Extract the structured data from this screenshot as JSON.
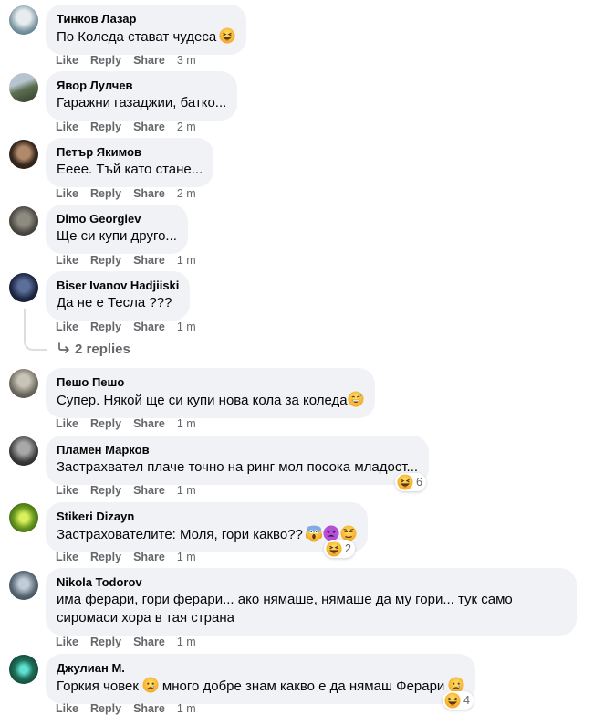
{
  "actions": {
    "like": "Like",
    "reply": "Reply",
    "share": "Share"
  },
  "comments": [
    {
      "author": "Тинков Лазар",
      "text": "По Коледа стават чудеса",
      "time": "3 m",
      "emoji": [
        "laughing"
      ]
    },
    {
      "author": "Явор Лулчев",
      "text": "Гаражни газаджии, батко...",
      "time": "2 m"
    },
    {
      "author": "Петър Якимов",
      "text": "Ееее. Тъй като стане...",
      "time": "2 m"
    },
    {
      "author": "Dimo Georgiev",
      "text": "Ще си купи друго...",
      "time": "1 m"
    },
    {
      "author": "Biser Ivanov Hadjiiski",
      "text": "Да не е Тесла ???",
      "time": "1 m",
      "replies": "2 replies"
    },
    {
      "author": "Пешо Пешо",
      "text": "Супер. Някой ще си купи нова кола за коледа",
      "time": "1 m",
      "emoji": [
        "grinning-sweat"
      ]
    },
    {
      "author": "Пламен Марков",
      "text": "Застрахвател плаче точно на ринг мол посока младост...",
      "time": "1 m",
      "reactions": {
        "icons": [
          "haha"
        ],
        "count": "6"
      }
    },
    {
      "author": "Stikeri Dizayn",
      "text": "Застрахователите: Моля, гори какво??",
      "time": "1 m",
      "emoji": [
        "scream",
        "tired",
        "unamused"
      ],
      "reactions": {
        "icons": [
          "haha"
        ],
        "count": "2"
      }
    },
    {
      "author": "Nikola Todorov",
      "text": "има ферари, гори ферари... ако нямаше, нямаше да му гори... тук само сиромаси хора в тая страна",
      "time": "1 m"
    },
    {
      "author": "Джулиан М.",
      "text": "Горкия човек",
      "text2": "много добре знам какво е да нямаш Ферари",
      "time": "1 m",
      "emoji": [
        "sad"
      ],
      "emoji2": [
        "sad"
      ],
      "reactions": {
        "icons": [
          "haha"
        ],
        "count": "4"
      }
    }
  ],
  "colors": {
    "bubble": "#f0f2f5",
    "meta": "#65676b",
    "haha": "#f7b125"
  }
}
